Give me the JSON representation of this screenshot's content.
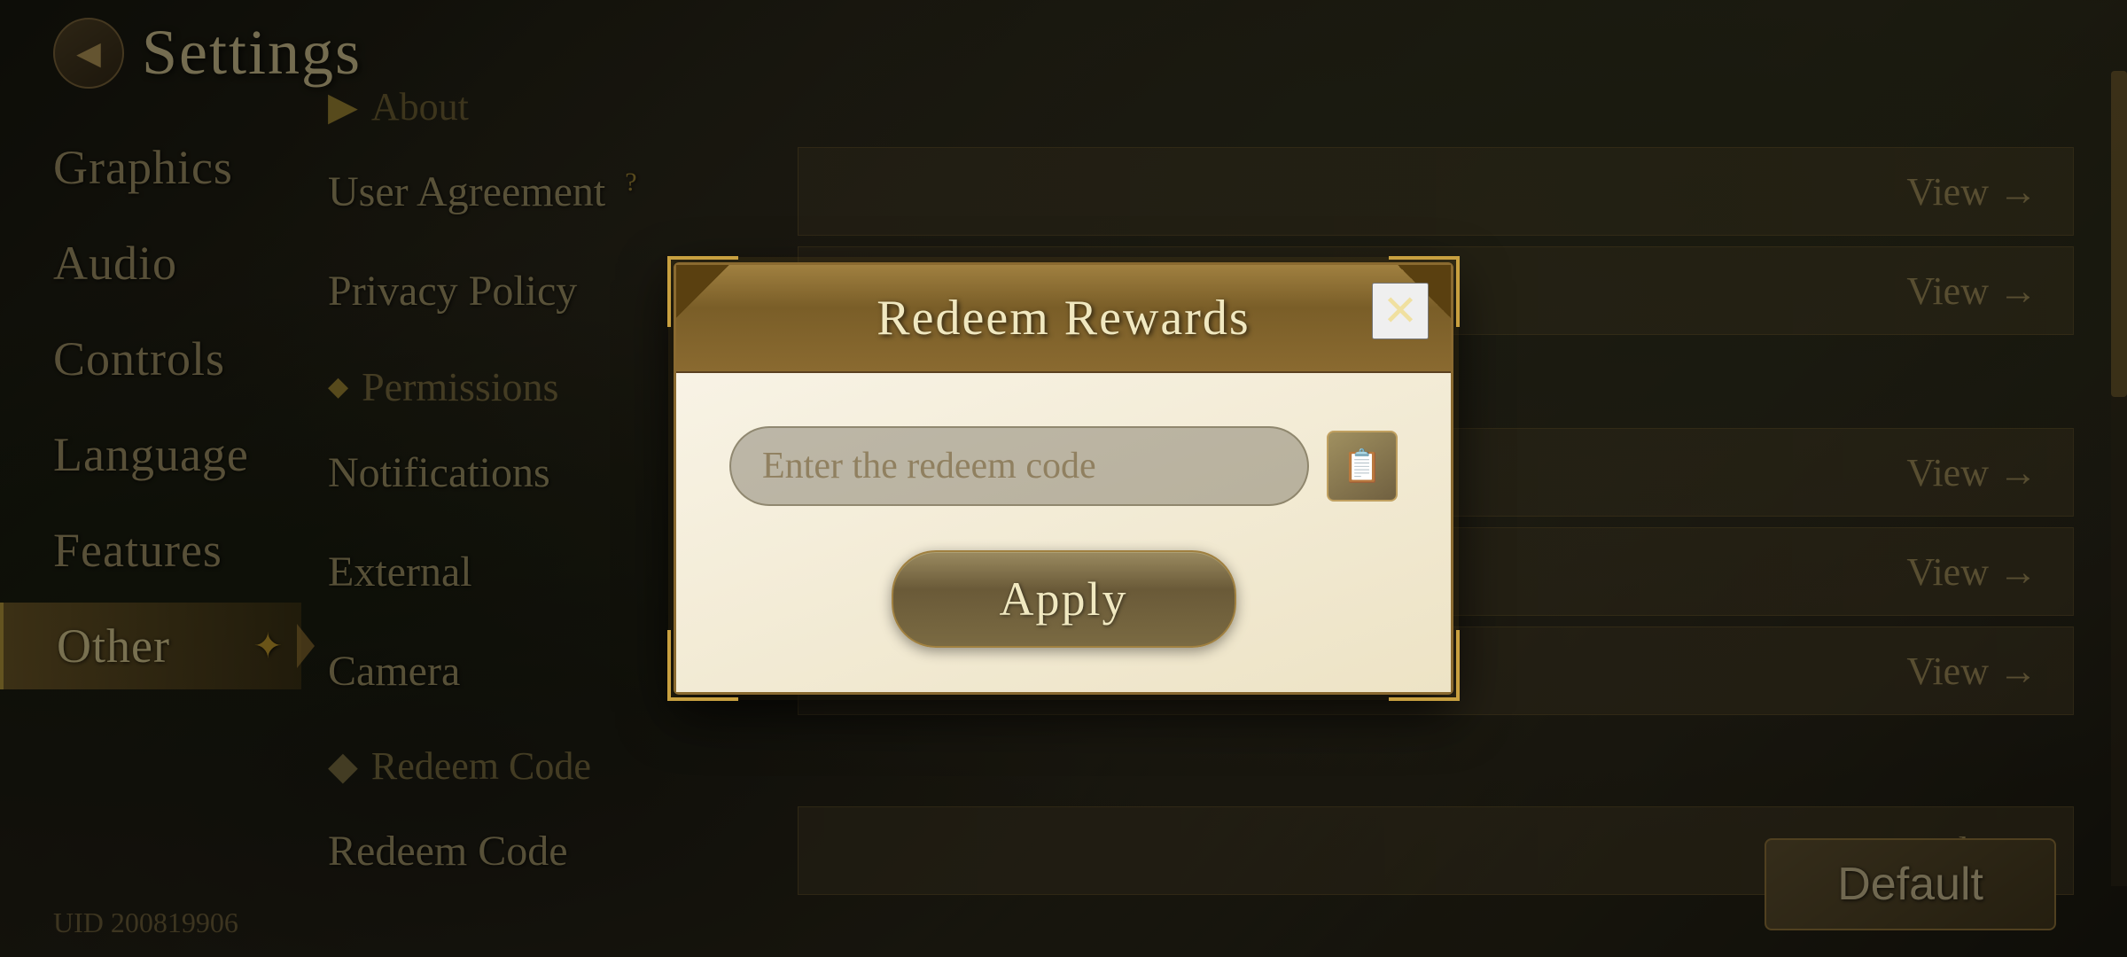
{
  "app": {
    "title": "Settings",
    "uid": "UID 200819906"
  },
  "sidebar": {
    "items": [
      {
        "id": "graphics",
        "label": "Graphics",
        "active": false
      },
      {
        "id": "audio",
        "label": "Audio",
        "active": false
      },
      {
        "id": "controls",
        "label": "Controls",
        "active": false
      },
      {
        "id": "language",
        "label": "Language",
        "active": false
      },
      {
        "id": "features",
        "label": "Features",
        "active": false
      },
      {
        "id": "other",
        "label": "Other",
        "active": true
      }
    ]
  },
  "main": {
    "about_header": "About",
    "rows": [
      {
        "id": "user-agreement",
        "label": "User Agreement",
        "badge": "?",
        "control": "View →"
      },
      {
        "id": "privacy",
        "label": "Privacy Policy",
        "badge": "",
        "control": "View →"
      },
      {
        "id": "notifications",
        "label": "Notifications",
        "badge": "",
        "control": "View →"
      },
      {
        "id": "external",
        "label": "External",
        "badge": "",
        "control": "View →"
      },
      {
        "id": "camera",
        "label": "Camera",
        "badge": "",
        "control": "View →"
      },
      {
        "id": "redeem-code",
        "label": "Redeem Code",
        "badge": "",
        "control": "Apply →"
      }
    ],
    "permissions_header": "Permissions",
    "redeem_header": "Redeem Code",
    "default_btn": "Default"
  },
  "modal": {
    "title": "Redeem Rewards",
    "close_label": "✕",
    "input_placeholder": "Enter the redeem code",
    "apply_label": "Apply",
    "paste_icon": "📋"
  },
  "icons": {
    "back": "◀",
    "diamond": "◆",
    "arrow_right": "→",
    "sparkle": "✦"
  }
}
